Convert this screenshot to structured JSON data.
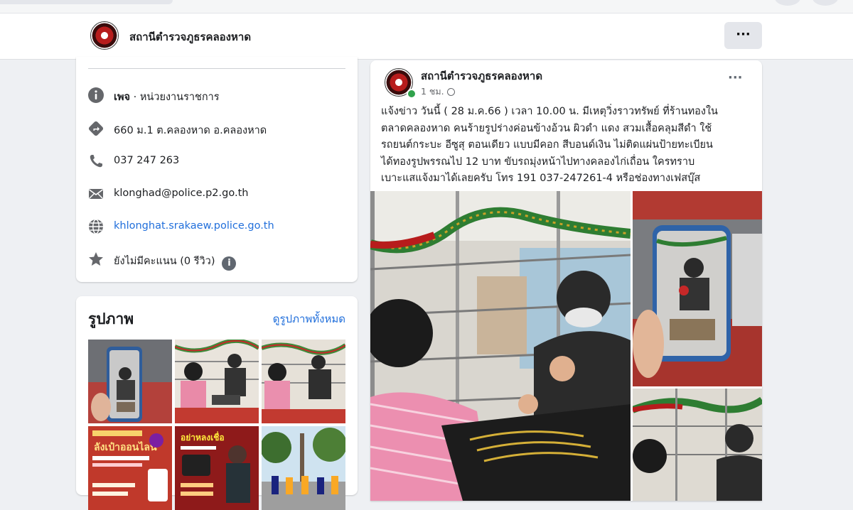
{
  "page": {
    "name": "สถานีตำรวจภูธรคลองหาด",
    "more_label": "···"
  },
  "about": {
    "category_bold": "เพจ",
    "category_rest": " · หน่วยงานราชการ",
    "address": "660 ม.1 ต.คลองหาด อ.คลองหาด",
    "phone": "037 247 263",
    "email": "klonghad@police.p2.go.th",
    "website": "khlonghat.srakaew.police.go.th",
    "rating": "ยังไม่มีคะแนน (0 รีวิว)",
    "rating_info": "i"
  },
  "photos": {
    "heading": "รูปภาพ",
    "see_all": "ดูรูปภาพทั้งหมด",
    "thumb_texts": {
      "poster1_title": "ลังเป๋าออนไลน์",
      "poster2_title": "อย่าหลงเชื่อ"
    }
  },
  "post": {
    "author": "สถานีตำรวจภูธรคลองหาด",
    "time": "1 ชม.",
    "more_label": "···",
    "lines": [
      "แจ้งข่าว  วันนี้ ( 28 ม.ค.66 ) เวลา 10.00 น. มีเหตุวิ่งราวทรัพย์ ที่ร้านทองใน",
      "ตลาดคลองหาด คนร้ายรูปร่างค่อนข้างอ้วน ผิวดำ แดง สวมเสื้อคลุมสีดำ  ใช้",
      "รถยนต์กระบะ อีซูสุ ตอนเดียว แบบมีคอก สีบอนด์เงิน ไม่ติดแผ่นป้ายทะเบียน",
      "ได้ทองรูปพรรณไป 12 บาท  ขับรถมุ่งหน้าไปทางคลองไก่เถื่อน ใครทราบ",
      "เบาะแสแจ้งมาได้เลยครับ โทร 191 037-247261-4 หรือช่องทางเฟสบุ๊ส"
    ]
  },
  "colors": {
    "link": "#216fdb",
    "online": "#31a24c",
    "logo_red": "#b71c1c"
  }
}
